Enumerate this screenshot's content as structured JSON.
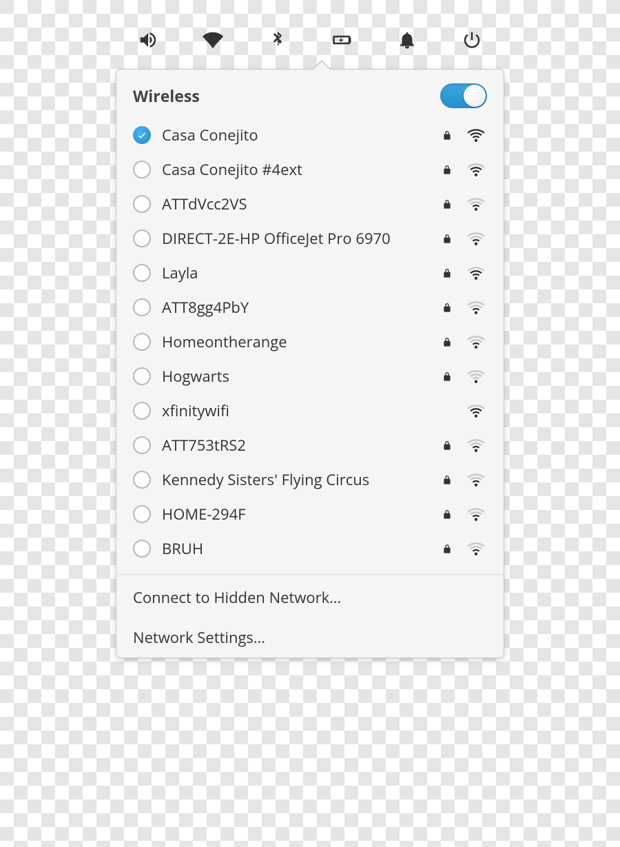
{
  "tray": {
    "icons": [
      "volume",
      "wifi",
      "bluetooth",
      "battery",
      "notifications",
      "power"
    ]
  },
  "popover": {
    "title": "Wireless",
    "toggle_on": true,
    "networks": [
      {
        "ssid": "Casa Conejito",
        "selected": true,
        "secured": true,
        "signal": 4
      },
      {
        "ssid": "Casa Conejito #4ext",
        "selected": false,
        "secured": true,
        "signal": 3
      },
      {
        "ssid": "ATTdVcc2VS",
        "selected": false,
        "secured": true,
        "signal": 2
      },
      {
        "ssid": "DIRECT-2E-HP OfficeJet Pro 6970",
        "selected": false,
        "secured": true,
        "signal": 2
      },
      {
        "ssid": "Layla",
        "selected": false,
        "secured": true,
        "signal": 3
      },
      {
        "ssid": "ATT8gg4PbY",
        "selected": false,
        "secured": true,
        "signal": 2
      },
      {
        "ssid": "Homeontherange",
        "selected": false,
        "secured": true,
        "signal": 2
      },
      {
        "ssid": "Hogwarts",
        "selected": false,
        "secured": true,
        "signal": 1
      },
      {
        "ssid": "xfinitywifi",
        "selected": false,
        "secured": false,
        "signal": 3
      },
      {
        "ssid": "ATT753tRS2",
        "selected": false,
        "secured": true,
        "signal": 2
      },
      {
        "ssid": "Kennedy Sisters' Flying Circus",
        "selected": false,
        "secured": true,
        "signal": 2
      },
      {
        "ssid": "HOME-294F",
        "selected": false,
        "secured": true,
        "signal": 2
      },
      {
        "ssid": "BRUH",
        "selected": false,
        "secured": true,
        "signal": 2
      }
    ],
    "footer": {
      "connect_hidden": "Connect to Hidden Network…",
      "network_settings": "Network Settings…"
    }
  },
  "colors": {
    "accent": "#2690cd"
  }
}
